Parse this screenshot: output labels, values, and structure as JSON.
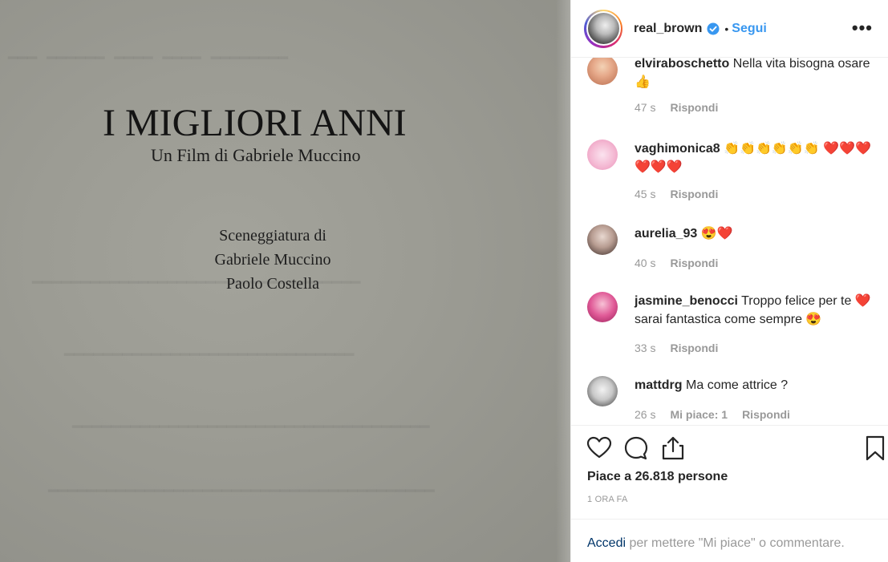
{
  "photo": {
    "title": "I MIGLIORI ANNI",
    "subtitle": "Un Film di Gabriele Muccino",
    "credits": [
      "Sceneggiatura di",
      "Gabriele Muccino",
      "Paolo Costella"
    ]
  },
  "header": {
    "username": "real_brown",
    "separator": "•",
    "follow_label": "Segui",
    "more_label": "•••"
  },
  "comments": [
    {
      "user": "elviraboschetto",
      "text": "Nella vita bisogna osare👍",
      "time": "47 s",
      "likes": "",
      "reply": "Rispondi"
    },
    {
      "user": "vaghimonica8",
      "text": "👏👏👏👏👏👏 ❤️❤️❤️❤️❤️❤️",
      "time": "45 s",
      "likes": "",
      "reply": "Rispondi"
    },
    {
      "user": "aurelia_93",
      "text": "😍❤️",
      "time": "40 s",
      "likes": "",
      "reply": "Rispondi"
    },
    {
      "user": "jasmine_benocci",
      "text": "Troppo felice per te ❤️ sarai fantastica come sempre 😍",
      "time": "33 s",
      "likes": "",
      "reply": "Rispondi"
    },
    {
      "user": "mattdrg",
      "text": "Ma come attrice ?",
      "time": "26 s",
      "likes": "Mi piace: 1",
      "reply": "Rispondi"
    }
  ],
  "post": {
    "likes_text": "Piace a 26.818 persone",
    "time_ago": "1 ORA FA"
  },
  "login": {
    "link": "Accedi",
    "rest": " per mettere \"Mi piace\" o commentare."
  },
  "colors": {
    "link_blue": "#3897f0",
    "login_blue": "#003569",
    "muted": "#999999",
    "heart_red": "#ed4956"
  }
}
